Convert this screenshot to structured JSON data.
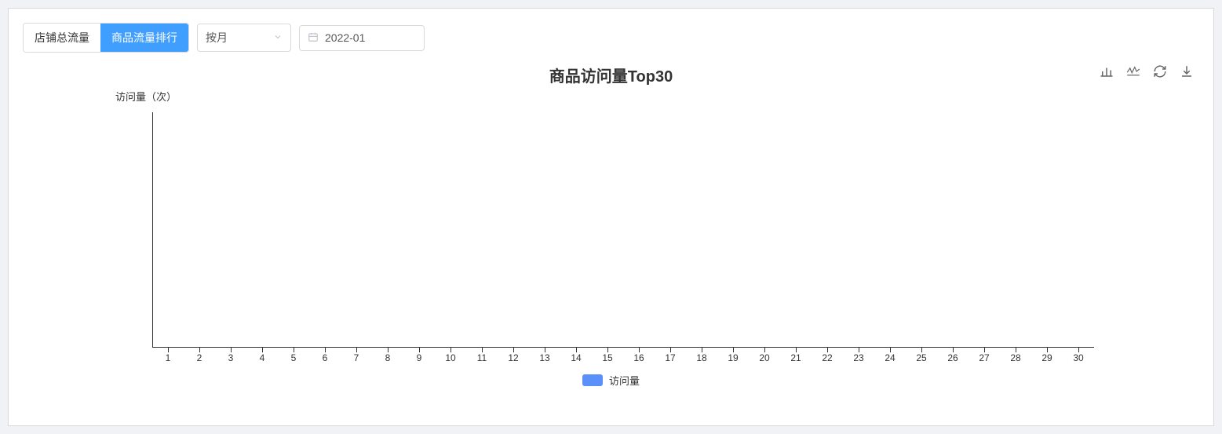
{
  "tabs": {
    "store_total": "店铺总流量",
    "product_rank": "商品流量排行"
  },
  "period_select": {
    "label": "按月"
  },
  "datepicker": {
    "value": "2022-01"
  },
  "chart_data": {
    "type": "bar",
    "title": "商品访问量Top30",
    "ylabel": "访问量（次）",
    "categories": [
      "1",
      "2",
      "3",
      "4",
      "5",
      "6",
      "7",
      "8",
      "9",
      "10",
      "11",
      "12",
      "13",
      "14",
      "15",
      "16",
      "17",
      "18",
      "19",
      "20",
      "21",
      "22",
      "23",
      "24",
      "25",
      "26",
      "27",
      "28",
      "29",
      "30"
    ],
    "series": [
      {
        "name": "访问量",
        "values": [
          0,
          0,
          0,
          0,
          0,
          0,
          0,
          0,
          0,
          0,
          0,
          0,
          0,
          0,
          0,
          0,
          0,
          0,
          0,
          0,
          0,
          0,
          0,
          0,
          0,
          0,
          0,
          0,
          0,
          0
        ]
      }
    ],
    "ylim": [
      0,
      0
    ],
    "legend": [
      "访问量"
    ]
  }
}
